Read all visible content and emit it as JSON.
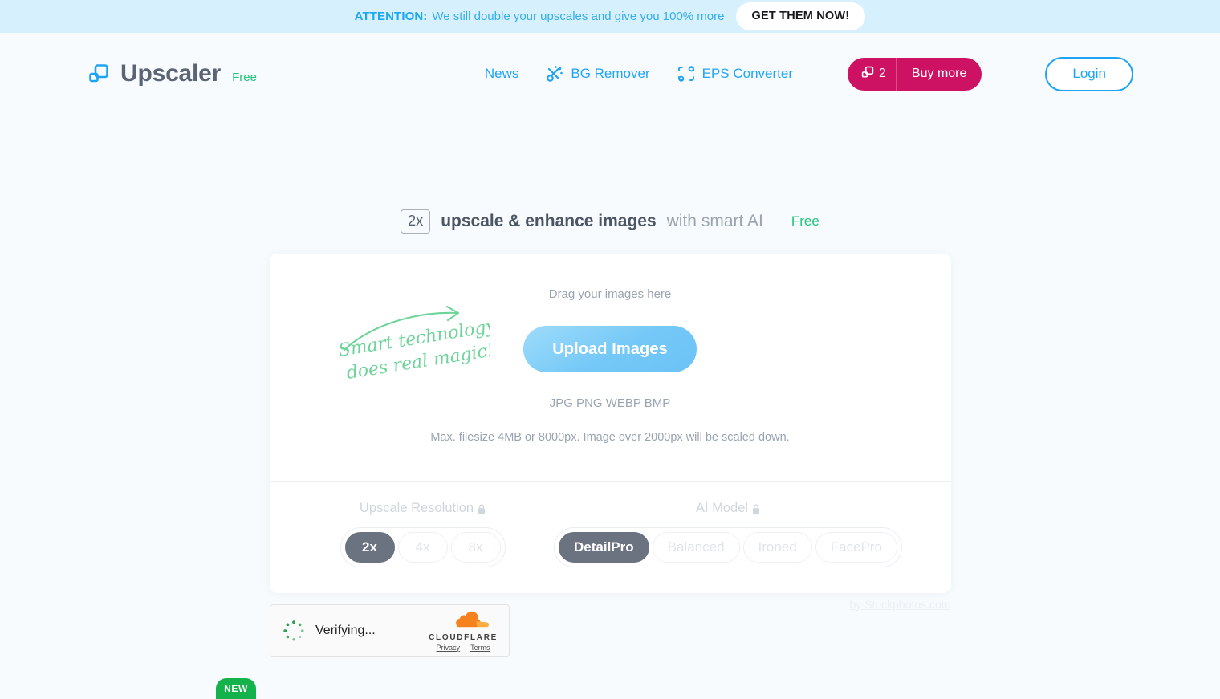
{
  "banner": {
    "attention": "ATTENTION:",
    "message": "We still double your upscales and give you 100% more",
    "cta": "GET THEM NOW!"
  },
  "header": {
    "brand_name": "Upscaler",
    "brand_badge": "Free",
    "logo_icon": "upscaler-squares-icon",
    "nav": [
      {
        "label": "News",
        "icon": null
      },
      {
        "label": "BG Remover",
        "icon": "scissors-icon"
      },
      {
        "label": "EPS Converter",
        "icon": "vector-nodes-icon"
      }
    ],
    "credits": {
      "icon": "credits-squares-icon",
      "count": "2",
      "buy_label": "Buy more"
    },
    "login_label": "Login"
  },
  "hero": {
    "badge": "2x",
    "strong": "upscale & enhance images",
    "light": "with smart AI",
    "free": "Free"
  },
  "dropzone": {
    "drag_hint": "Drag your images here",
    "upload_button": "Upload Images",
    "formats": "JPG PNG WEBP BMP",
    "limits": "Max. filesize 4MB or 8000px. Image over 2000px will be scaled down.",
    "doodle_text": "Smart technology does real magic!"
  },
  "settings": {
    "resolution": {
      "label": "Upscale Resolution",
      "lock_icon": "lock-icon",
      "options": [
        "2x",
        "4x",
        "8x"
      ],
      "selected": "2x"
    },
    "model": {
      "label": "AI Model",
      "lock_icon": "lock-icon",
      "options": [
        "DetailPro",
        "Balanced",
        "Ironed",
        "FacePro"
      ],
      "selected": "DetailPro"
    }
  },
  "byline": "by Stockphotos.com",
  "turnstile": {
    "status": "Verifying...",
    "brand": "CLOUDFLARE",
    "privacy": "Privacy",
    "separator": "·",
    "terms": "Terms",
    "logo_icon": "cloudflare-cloud-icon",
    "spinner_icon": "loading-spinner-icon"
  },
  "new_badge": "NEW",
  "colors": {
    "accent_blue": "#1fa4f3",
    "banner_bg": "#d6f0fd",
    "credits_pink": "#cd1263",
    "green": "#21c47a",
    "page_bg": "#f7fbfd"
  }
}
